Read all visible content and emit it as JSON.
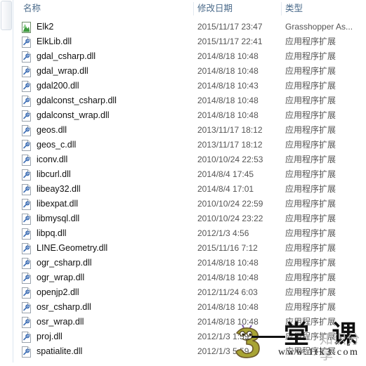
{
  "window": {
    "kind": "file-explorer-details-view"
  },
  "columns": {
    "name": "名称",
    "date_modified": "修改日期",
    "type": "类型"
  },
  "files": [
    {
      "name": "Elk2",
      "date": "2015/11/17 23:47",
      "type": "Grasshopper As...",
      "icon": "grasshopper-assembly-icon"
    },
    {
      "name": "ElkLib.dll",
      "date": "2015/11/17 22:41",
      "type": "应用程序扩展",
      "icon": "dll-file-icon"
    },
    {
      "name": "gdal_csharp.dll",
      "date": "2014/8/18 10:48",
      "type": "应用程序扩展",
      "icon": "dll-file-icon"
    },
    {
      "name": "gdal_wrap.dll",
      "date": "2014/8/18 10:48",
      "type": "应用程序扩展",
      "icon": "dll-file-icon"
    },
    {
      "name": "gdal200.dll",
      "date": "2014/8/18 10:43",
      "type": "应用程序扩展",
      "icon": "dll-file-icon"
    },
    {
      "name": "gdalconst_csharp.dll",
      "date": "2014/8/18 10:48",
      "type": "应用程序扩展",
      "icon": "dll-file-icon"
    },
    {
      "name": "gdalconst_wrap.dll",
      "date": "2014/8/18 10:48",
      "type": "应用程序扩展",
      "icon": "dll-file-icon"
    },
    {
      "name": "geos.dll",
      "date": "2013/11/17 18:12",
      "type": "应用程序扩展",
      "icon": "dll-file-icon"
    },
    {
      "name": "geos_c.dll",
      "date": "2013/11/17 18:12",
      "type": "应用程序扩展",
      "icon": "dll-file-icon"
    },
    {
      "name": "iconv.dll",
      "date": "2010/10/24 22:53",
      "type": "应用程序扩展",
      "icon": "dll-file-icon"
    },
    {
      "name": "libcurl.dll",
      "date": "2014/8/4 17:45",
      "type": "应用程序扩展",
      "icon": "dll-file-icon"
    },
    {
      "name": "libeay32.dll",
      "date": "2014/8/4 17:01",
      "type": "应用程序扩展",
      "icon": "dll-file-icon"
    },
    {
      "name": "libexpat.dll",
      "date": "2010/10/24 22:59",
      "type": "应用程序扩展",
      "icon": "dll-file-icon"
    },
    {
      "name": "libmysql.dll",
      "date": "2010/10/24 23:22",
      "type": "应用程序扩展",
      "icon": "dll-file-icon"
    },
    {
      "name": "libpq.dll",
      "date": "2012/1/3 4:56",
      "type": "应用程序扩展",
      "icon": "dll-file-icon"
    },
    {
      "name": "LINE.Geometry.dll",
      "date": "2015/11/16 7:12",
      "type": "应用程序扩展",
      "icon": "dll-file-icon"
    },
    {
      "name": "ogr_csharp.dll",
      "date": "2014/8/18 10:48",
      "type": "应用程序扩展",
      "icon": "dll-file-icon"
    },
    {
      "name": "ogr_wrap.dll",
      "date": "2014/8/18 10:48",
      "type": "应用程序扩展",
      "icon": "dll-file-icon"
    },
    {
      "name": "openjp2.dll",
      "date": "2012/11/24 6:03",
      "type": "应用程序扩展",
      "icon": "dll-file-icon"
    },
    {
      "name": "osr_csharp.dll",
      "date": "2014/8/18 10:48",
      "type": "应用程序扩展",
      "icon": "dll-file-icon"
    },
    {
      "name": "osr_wrap.dll",
      "date": "2014/8/18 10:48",
      "type": "应用程序扩展",
      "icon": "dll-file-icon"
    },
    {
      "name": "proj.dll",
      "date": "2012/1/3 1:59",
      "type": "应用程序扩展",
      "icon": "dll-file-icon"
    },
    {
      "name": "spatialite.dll",
      "date": "2012/1/3 5:59",
      "type": "应用程序扩展",
      "icon": "dll-file-icon"
    }
  ],
  "watermark": {
    "title": "堂 课",
    "url": "www.1tk3.com",
    "subtitle": "知识分享",
    "dots": "· ·"
  }
}
